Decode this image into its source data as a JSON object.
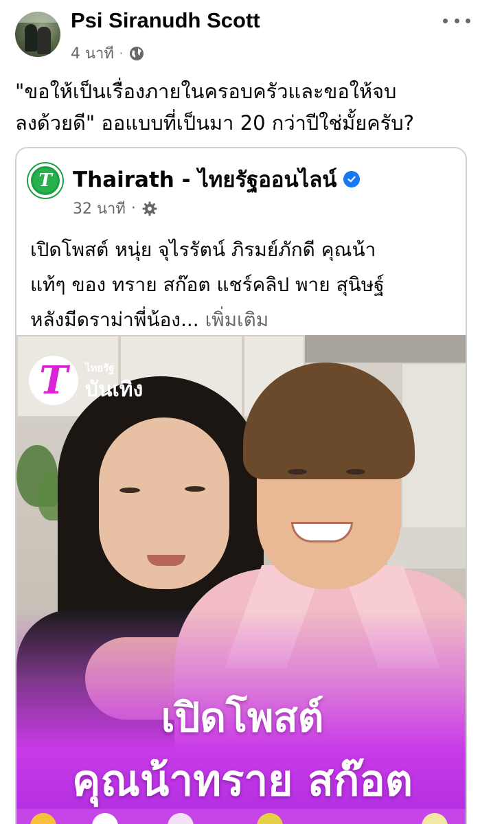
{
  "post": {
    "author": "Psi Siranudh Scott",
    "time": "4 นาที",
    "separator": "·",
    "text_lines": [
      "\"ขอให้เป็นเรื่องภายในครอบครัวและขอให้จบ",
      "ลงด้วยดี\" ออแบบที่เป็นมา 20 กว่าปีใช่มั้ยครับ?"
    ]
  },
  "shared": {
    "page_name": "Thairath - ไทยรัฐออนไลน์",
    "time": "32 นาที",
    "separator": "·",
    "text_lines": [
      "เปิดโพสต์ หนุ่ย จุไรรัตน์ ภิรมย์ภักดี คุณน้า",
      "แท้ๆ ของ ทราย สก๊อต แชร์คลิป พาย สุนิษฐ์",
      "หลังมีดราม่าพี่น้อง..."
    ],
    "see_more": "เพิ่มเติม",
    "image": {
      "brand_small": "ไทยรัฐ",
      "brand_big": "บันเทิง",
      "headline_line1": "เปิดโพสต์",
      "headline_line2": "คุณน้าทราย สก๊อต"
    }
  },
  "colors": {
    "accent": "#1877f2",
    "secondary_text": "#65676b",
    "thairath_green": "#1aa043",
    "overlay_purple": "#c93ae8"
  },
  "icons": [
    "globe-icon",
    "more-options-icon",
    "settings-icon",
    "verified-badge-icon"
  ]
}
